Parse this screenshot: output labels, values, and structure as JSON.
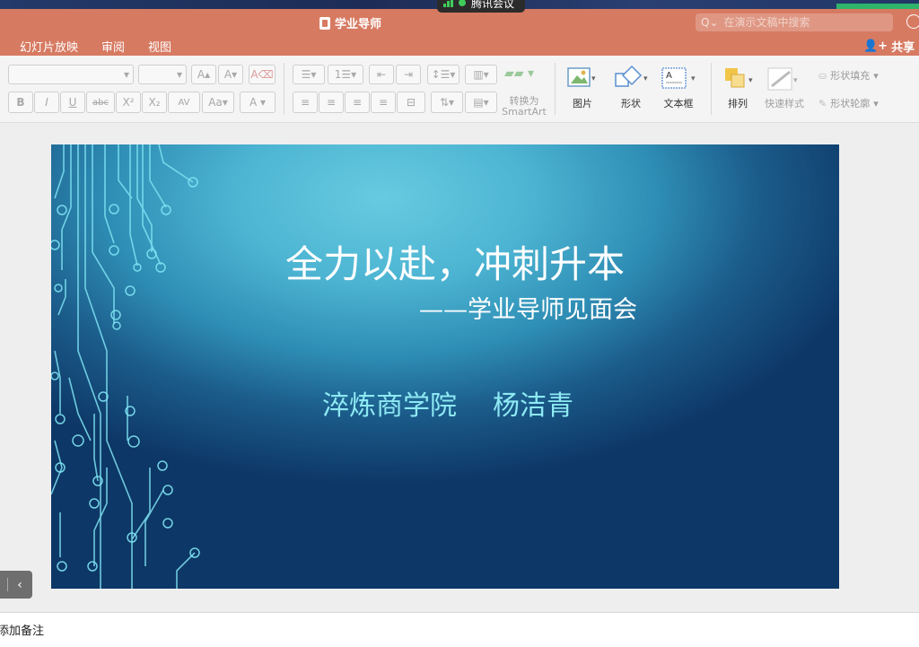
{
  "window": {
    "title": "学业导师"
  },
  "meeting": {
    "label": "腾讯会议"
  },
  "search": {
    "placeholder": "在演示文稿中搜索"
  },
  "menu": {
    "items": [
      "幻灯片放映",
      "审阅",
      "视图"
    ]
  },
  "share": {
    "label": "共享"
  },
  "toolbar": {
    "bold": "B",
    "italic": "I",
    "underline": "U",
    "strike": "abc",
    "superscript": "X²",
    "subscript": "X₂",
    "spacing": "AV",
    "font_color": "A",
    "smartart": "转换为\nSmartArt",
    "picture": "图片",
    "shape": "形状",
    "textbox": "文本框",
    "arrange": "排列",
    "quick_styles": "快速样式",
    "shape_fill": "形状填充",
    "shape_outline": "形状轮廓"
  },
  "slide": {
    "title": "全力以赴，冲刺升本",
    "subtitle": "——学业导师见面会",
    "org": "淬炼商学院",
    "author": "杨洁青"
  },
  "notes": {
    "placeholder": "添加备注"
  },
  "colors": {
    "accent": "#d77a62",
    "slide_text": "#ffffff",
    "author_text": "#8ee9f3"
  }
}
